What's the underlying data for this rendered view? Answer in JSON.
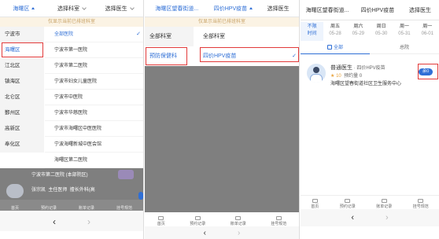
{
  "panel_a": {
    "district": "海曙区",
    "department": "选择科室",
    "doctor": "选择医生",
    "banner": "仅显示当前已排班科室",
    "districts": [
      "宁波市",
      "海曙区",
      "江北区",
      "镇海区",
      "北仑区",
      "鄞州区",
      "高新区",
      "奉化区"
    ],
    "selected_district_index": 1,
    "hospitals": [
      "全部医院",
      "宁波市第一医院",
      "宁波市第二医院",
      "宁波市妇女儿童医院",
      "宁波市中医院",
      "宁波市华慈医院",
      "宁波市海曙区中医医院",
      "宁波海曙新城中医会馆",
      "海曙区第二医院"
    ],
    "selected_hospital_index": 0,
    "behind": {
      "hospital_line": "宁波市第二医院 (本部院区)",
      "doctor_name": "张宗凯",
      "doctor_title": "主任医师",
      "doctor_specialty": "擅长外科(高"
    },
    "tabs": [
      "首页",
      "预约记录",
      "账单记录",
      "挂号规范"
    ],
    "nav": {
      "back": "‹",
      "forward": "›"
    }
  },
  "panel_b": {
    "location": "海曙区望春街道...",
    "vaccine": "四价HPV疫苗",
    "doctor": "选择医生",
    "banner": "仅显示当前已排班科室",
    "left_items": [
      "全部科室",
      "预防保健科"
    ],
    "selected_left_index": 1,
    "right_items": [
      "全部科室",
      "四价HPV疫苗"
    ],
    "selected_right_index": 1,
    "tabs": [
      "首页",
      "预约记录",
      "账单记录",
      "挂号规范"
    ],
    "nav": {
      "back": "‹",
      "forward": "›"
    }
  },
  "panel_c": {
    "location": "海曙区望春街道...",
    "vaccine": "四价HPV疫苗",
    "doctor": "选择医生",
    "dates": [
      {
        "day": "不限",
        "sub": "时间",
        "selected": true
      },
      {
        "day": "周五",
        "sub": "05-28"
      },
      {
        "day": "周六",
        "sub": "05-29"
      },
      {
        "day": "周日",
        "sub": "05-30"
      },
      {
        "day": "周一",
        "sub": "05-31"
      },
      {
        "day": "周一",
        "sub": "06-01"
      }
    ],
    "filter_all": "全部",
    "filter_hospital": "总院",
    "card": {
      "name": "普通医生",
      "dept": "四价HPV疫苗",
      "badge": "余0",
      "remain_label": "预约量",
      "remain_value": "0",
      "score": "10",
      "hospital": "海曙区望春街道社区卫生服务中心"
    },
    "tabs": [
      "首页",
      "预约记录",
      "账单记录",
      "挂号规范"
    ],
    "nav": {
      "back": "‹",
      "forward": "›"
    }
  },
  "colors": {
    "accent": "#2f6fd6",
    "highlight": "#e23a3a",
    "badge": "#2f6fd6"
  }
}
